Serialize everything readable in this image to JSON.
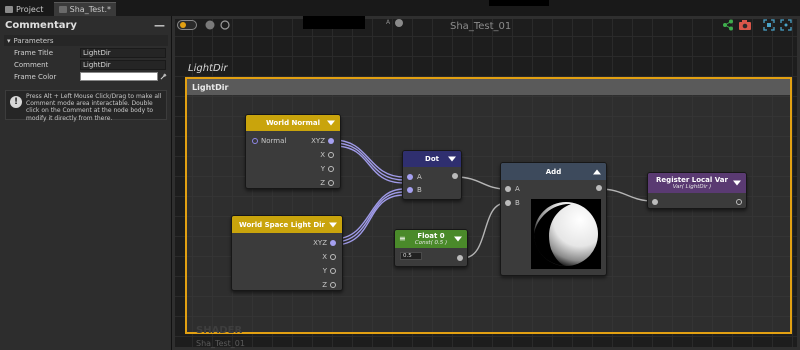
{
  "tabs": [
    {
      "label": "Project"
    },
    {
      "label": "Sha_Test.*"
    }
  ],
  "panel": {
    "title": "Commentary",
    "section": "Parameters",
    "frame_title_label": "Frame Title",
    "frame_title_value": "LightDir",
    "comment_label": "Comment",
    "comment_value": "LightDir",
    "frame_color_label": "Frame Color",
    "frame_color_value": "#ffffff",
    "info": "Press Alt + Left Mouse Click/Drag to make all Comment mode area interactable. Double click on the Comment at the node body to modify it directly from there."
  },
  "graph": {
    "title": "Sha_Test_01",
    "a_label": "A",
    "watermark": "SHADER",
    "watermark_sub": "Sha_Test_01"
  },
  "comment_frame": {
    "outer_label": "LightDir",
    "header": "LightDir",
    "border_color": "#e2a012"
  },
  "nodes": {
    "world_normal": {
      "title": "World Normal",
      "input": "Normal",
      "outputs": [
        "XYZ",
        "X",
        "Y",
        "Z"
      ],
      "color": "#c9a40c"
    },
    "light_dir": {
      "title": "World Space Light Dir",
      "outputs": [
        "XYZ",
        "X",
        "Y",
        "Z"
      ],
      "color": "#c9a40c"
    },
    "dot": {
      "title": "Dot",
      "inputs": [
        "A",
        "B"
      ],
      "color": "#2f2f6f"
    },
    "float": {
      "title": "Float 0",
      "subtitle": "Const( 0.5 )",
      "value": "0.5",
      "color": "#4a8a2a"
    },
    "add": {
      "title": "Add",
      "inputs": [
        "A",
        "B"
      ],
      "color": "#3d4a5c"
    },
    "register": {
      "title": "Register Local Var",
      "subtitle": "Var( LightDir )",
      "color": "#5a3a72"
    }
  }
}
